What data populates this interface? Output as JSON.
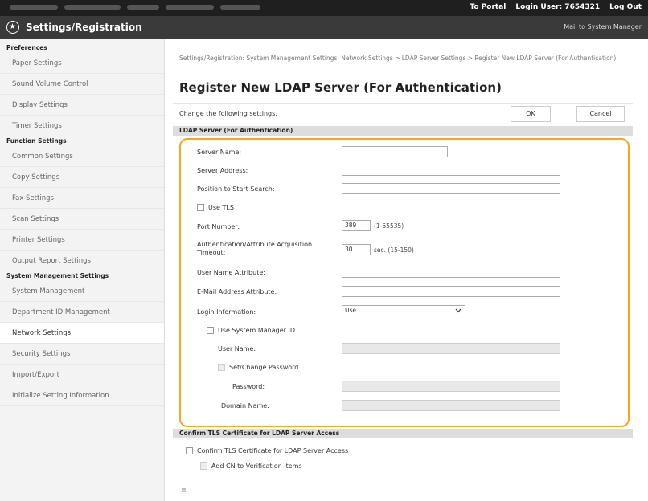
{
  "topbar": {
    "to_portal": "To Portal",
    "login_user": "Login User: 7654321",
    "logout": "Log Out"
  },
  "header": {
    "title": "Settings/Registration",
    "mail_to": "Mail to System Manager"
  },
  "sidebar": {
    "groups": [
      {
        "label": "Preferences",
        "items": [
          "Paper Settings",
          "Sound Volume Control",
          "Display Settings",
          "Timer Settings"
        ]
      },
      {
        "label": "Function Settings",
        "items": [
          "Common Settings",
          "Copy Settings",
          "Fax Settings",
          "Scan Settings",
          "Printer Settings",
          "Output Report Settings"
        ]
      },
      {
        "label": "System Management Settings",
        "items": [
          "System Management",
          "Department ID Management",
          "Network Settings",
          "Security Settings",
          "Import/Export",
          "Initialize Setting Information"
        ]
      }
    ]
  },
  "main": {
    "breadcrumb": "Settings/Registration: System Management Settings: Network Settings > LDAP Server Settings > Register New LDAP Server (For Authentication)",
    "title": "Register New LDAP Server (For Authentication)",
    "description": "Change the following settings.",
    "ok_label": "OK",
    "cancel_label": "Cancel",
    "section_ldap": "LDAP Server (For Authentication)",
    "fields": {
      "server_name": "Server Name:",
      "server_address": "Server Address:",
      "position_search": "Position to Start Search:",
      "use_tls": "Use TLS",
      "port_number": "Port Number:",
      "port_value": "389",
      "port_range": "(1-65535)",
      "timeout_label": "Authentication/Attribute Acquisition Timeout:",
      "timeout_value": "30",
      "timeout_range": "sec. (15-150)",
      "user_name_attr": "User Name Attribute:",
      "email_attr": "E-Mail Address Attribute:",
      "login_info": "Login Information:",
      "login_value": "Use",
      "use_sys_mgr": "Use System Manager ID",
      "user_name": "User Name:",
      "set_change_pw": "Set/Change Password",
      "password": "Password:",
      "domain_name": "Domain Name:"
    },
    "section_tls": "Confirm TLS Certificate for LDAP Server Access",
    "tls": {
      "confirm_cert": "Confirm TLS Certificate for LDAP Server Access",
      "add_cn": "Add CN to Verification Items"
    },
    "end_mark": "≣"
  },
  "colors": {
    "highlight": "#f5a623",
    "topbar": "#1f1f1f",
    "header": "#3a3a3a"
  }
}
